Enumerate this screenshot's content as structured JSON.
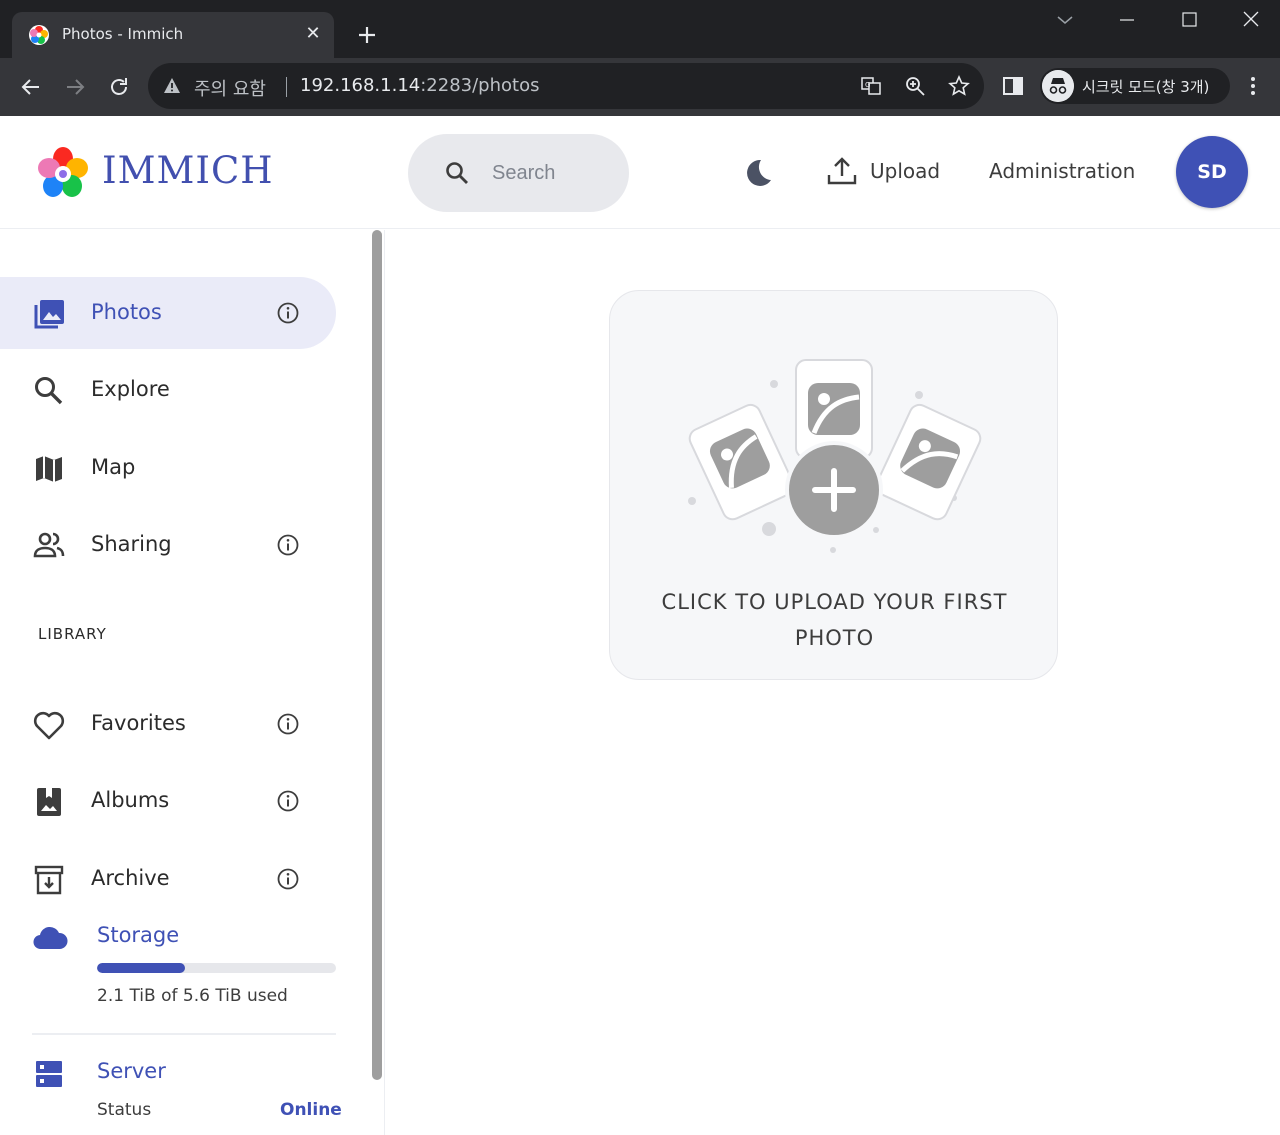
{
  "browser": {
    "tab_title": "Photos - Immich",
    "tab_close": "✕",
    "security_label": "주의 요함",
    "url_host": "192.168.1.14",
    "url_path": ":2283/photos",
    "incognito_label": "시크릿 모드(창 3개)"
  },
  "header": {
    "logo_text": "IMMICH",
    "search_placeholder": "Search",
    "upload_label": "Upload",
    "admin_label": "Administration",
    "avatar_initials": "SD"
  },
  "sidebar": {
    "items": [
      {
        "label": "Photos",
        "icon": "photos-icon",
        "active": true,
        "info": true
      },
      {
        "label": "Explore",
        "icon": "search-icon",
        "active": false,
        "info": false
      },
      {
        "label": "Map",
        "icon": "map-icon",
        "active": false,
        "info": false
      },
      {
        "label": "Sharing",
        "icon": "people-icon",
        "active": false,
        "info": true
      }
    ],
    "library_title": "LIBRARY",
    "library_items": [
      {
        "label": "Favorites",
        "icon": "heart-icon",
        "info": true
      },
      {
        "label": "Albums",
        "icon": "album-icon",
        "info": true
      },
      {
        "label": "Archive",
        "icon": "archive-icon",
        "info": true
      }
    ],
    "storage": {
      "title": "Storage",
      "usage_text": "2.1 TiB of 5.6 TiB used",
      "used_fraction": 0.37
    },
    "server": {
      "title": "Server",
      "status_label": "Status",
      "status_value": "Online"
    }
  },
  "main": {
    "upload_prompt": "CLICK TO UPLOAD YOUR FIRST PHOTO"
  },
  "colors": {
    "accent": "#3f51b5",
    "active_bg": "#eaebf8",
    "card_bg": "#f6f7f9",
    "illustration_gray": "#9e9e9e"
  }
}
